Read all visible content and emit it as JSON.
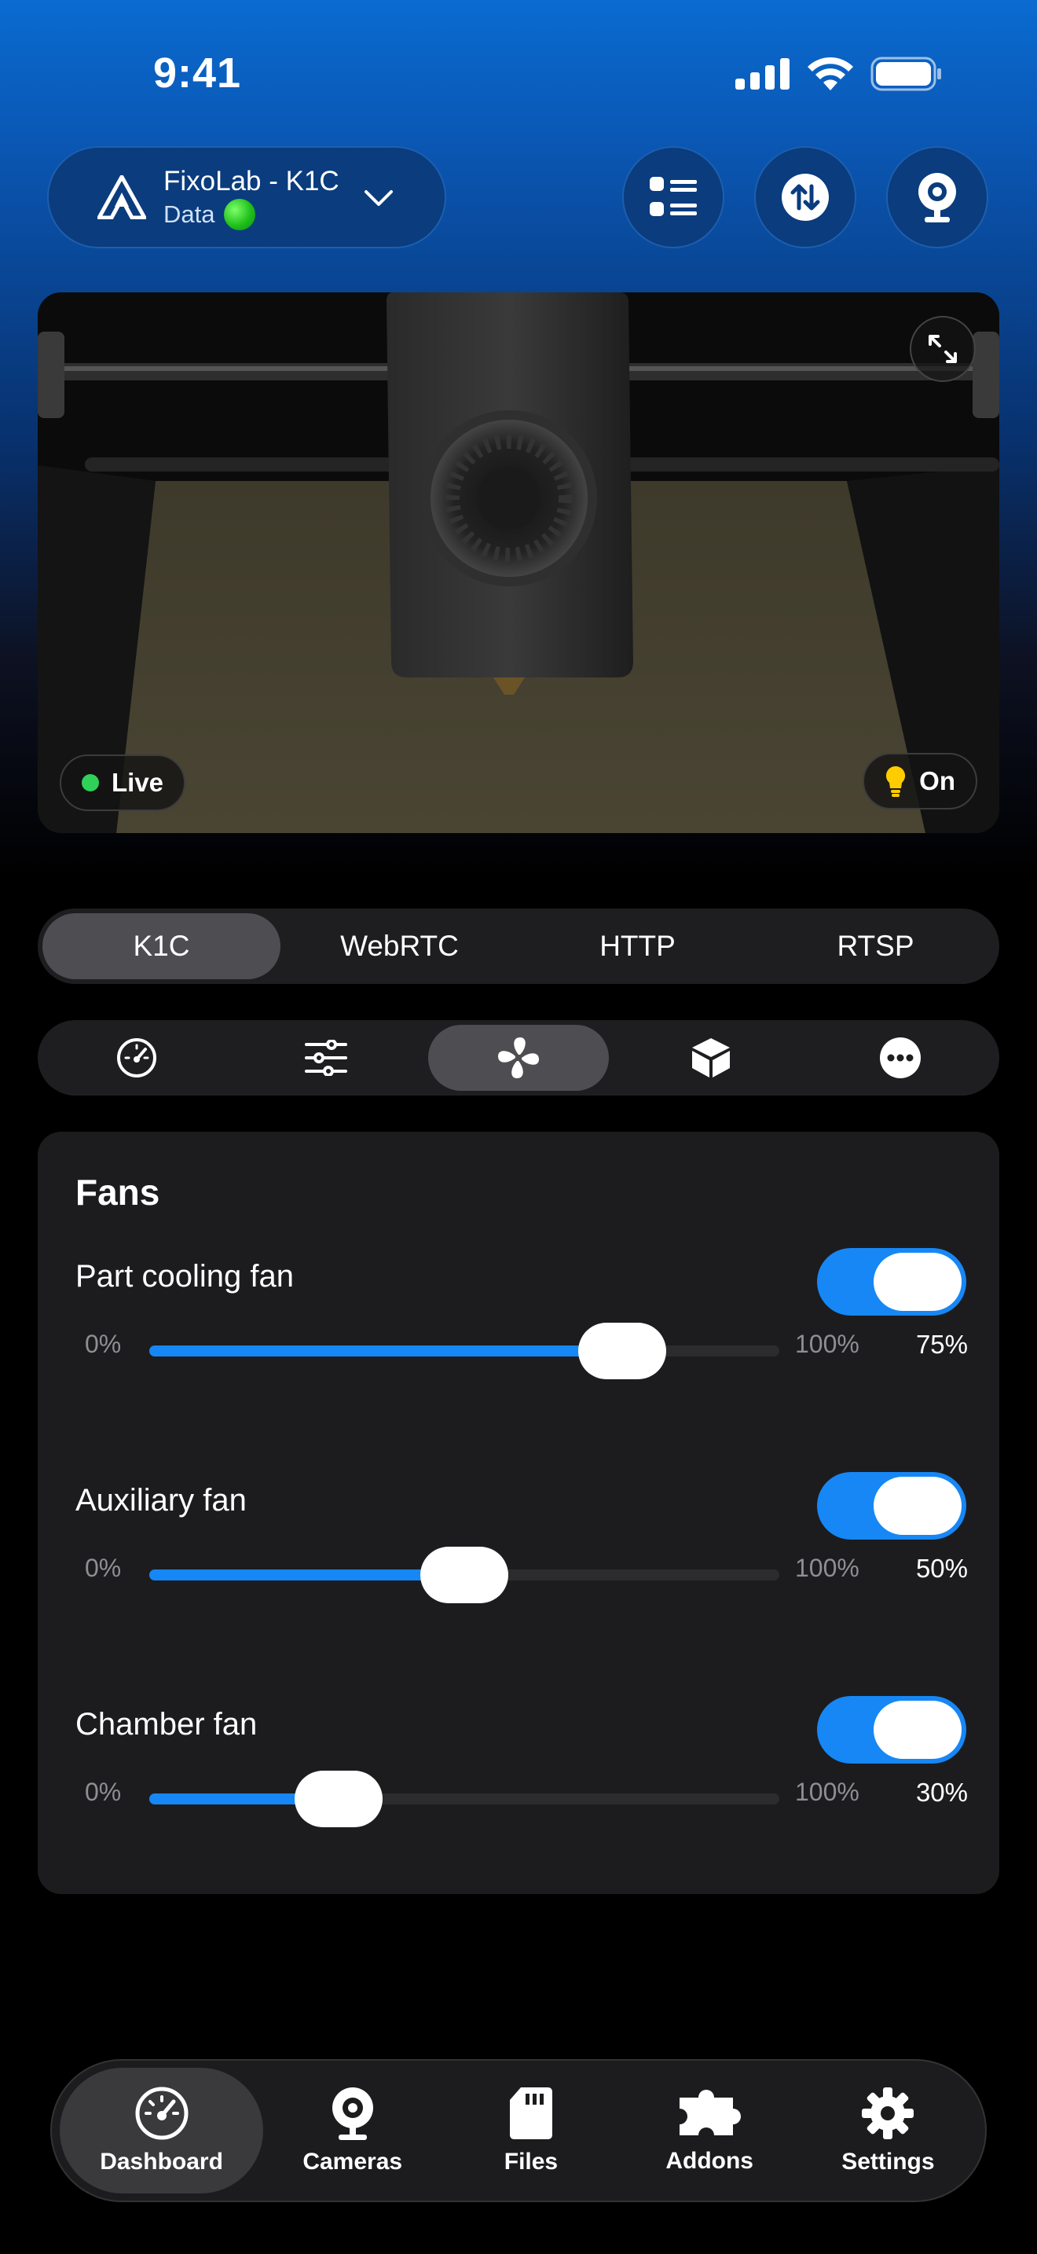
{
  "status_bar": {
    "time": "9:41"
  },
  "header": {
    "printer_name": "FixoLab - K1C",
    "printer_sub": "Data",
    "icons": [
      "list-icon",
      "transfer-icon",
      "webcam-icon"
    ]
  },
  "camera": {
    "live_label": "Live",
    "light_label": "On"
  },
  "stream_tabs": [
    "K1C",
    "WebRTC",
    "HTTP",
    "RTSP"
  ],
  "stream_selected": "K1C",
  "section_tabs": [
    "gauge-icon",
    "sliders-icon",
    "fan-icon",
    "box-icon",
    "more-icon"
  ],
  "section_selected": "fan-icon",
  "fans": {
    "title": "Fans",
    "items": [
      {
        "label": "Part cooling fan",
        "enabled": true,
        "min": "0%",
        "max": "100%",
        "value_label": "75%",
        "value": 0.75
      },
      {
        "label": "Auxiliary fan",
        "enabled": true,
        "min": "0%",
        "max": "100%",
        "value_label": "50%",
        "value": 0.5
      },
      {
        "label": "Chamber fan",
        "enabled": true,
        "min": "0%",
        "max": "100%",
        "value_label": "30%",
        "value": 0.3
      }
    ]
  },
  "nav": [
    {
      "label": "Dashboard",
      "icon": "dashboard-icon",
      "active": true
    },
    {
      "label": "Cameras",
      "icon": "camera-icon",
      "active": false
    },
    {
      "label": "Files",
      "icon": "sd-card-icon",
      "active": false
    },
    {
      "label": "Addons",
      "icon": "puzzle-icon",
      "active": false
    },
    {
      "label": "Settings",
      "icon": "gear-icon",
      "active": false
    }
  ],
  "colors": {
    "accent": "#1687f5",
    "card": "#1c1c1e",
    "live_dot": "#30d158"
  }
}
